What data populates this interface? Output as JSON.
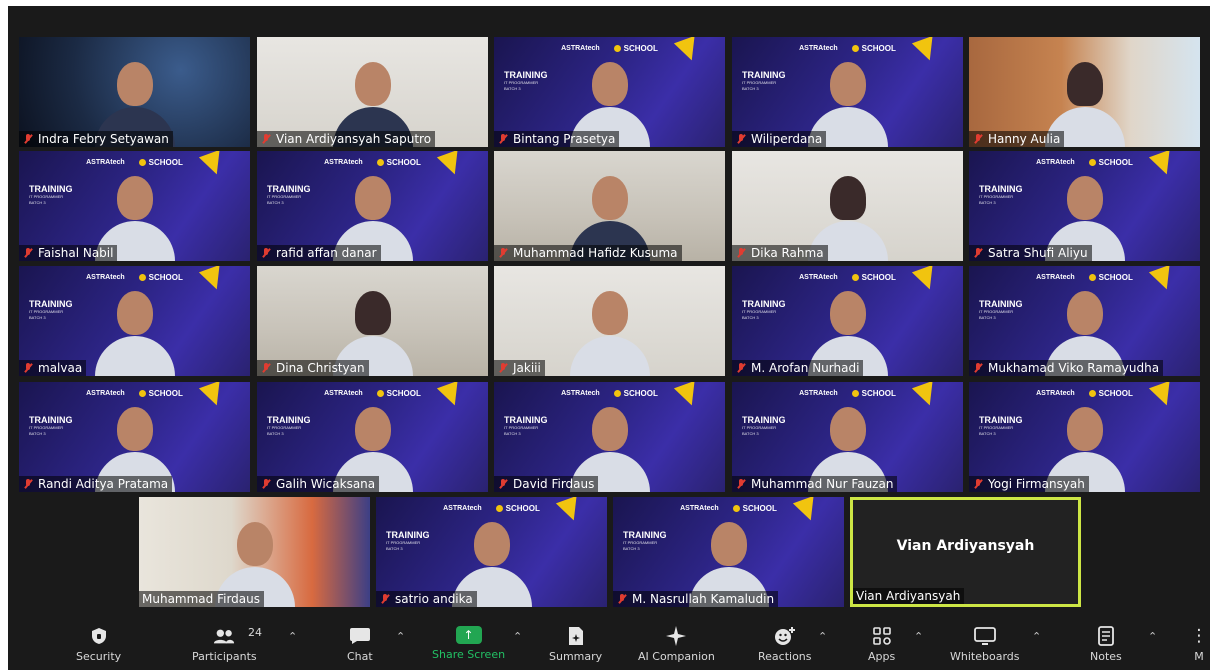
{
  "participants": [
    {
      "name": "Indra Febry Setyawan"
    },
    {
      "name": "Vian Ardiyansyah Saputro"
    },
    {
      "name": "Bintang Prasetya"
    },
    {
      "name": "Wiliperdana"
    },
    {
      "name": "Hanny Aulia"
    },
    {
      "name": "Faishal Nabil"
    },
    {
      "name": "rafid affan danar"
    },
    {
      "name": "Muhammad Hafidz Kusuma"
    },
    {
      "name": "Dika Rahma"
    },
    {
      "name": "Satra Shufi Aliyu"
    },
    {
      "name": "malvaa"
    },
    {
      "name": "Dina Christyan"
    },
    {
      "name": "Jakiii"
    },
    {
      "name": "M. Arofan Nurhadi"
    },
    {
      "name": "Mukhamad Viko Ramayudha"
    },
    {
      "name": "Randi Aditya Pratama"
    },
    {
      "name": "Galih Wicaksana"
    },
    {
      "name": "David Firdaus"
    },
    {
      "name": "Muhammad Nur Fauzan"
    },
    {
      "name": "Yogi Firmansyah"
    },
    {
      "name": "Muhammad Firdaus"
    },
    {
      "name": "satrio andika"
    },
    {
      "name": "M. Nasrullah Kamaludin"
    },
    {
      "name": "Vian Ardiyansyah"
    }
  ],
  "placeholder_tile": {
    "center_name": "Vian Ardiyansyah"
  },
  "banner": {
    "astra": "ASTRAtech",
    "school": "SCHOOL",
    "training": "TRAINING",
    "program": "IT PROGRAMMER",
    "batch": "BATCH 3"
  },
  "toolbar": {
    "security": "Security",
    "participants": "Participants",
    "participants_count": "24",
    "chat": "Chat",
    "share_screen": "Share Screen",
    "summary": "Summary",
    "ai_companion": "AI Companion",
    "reactions": "Reactions",
    "apps": "Apps",
    "whiteboards": "Whiteboards",
    "notes": "Notes",
    "more": "M"
  },
  "icons": {
    "security": "shield-icon",
    "participants": "people-icon",
    "chat": "speech-bubble-icon",
    "share_screen": "share-arrow-icon",
    "summary": "document-sparkle-icon",
    "ai_companion": "sparkle-icon",
    "reactions": "smiley-plus-icon",
    "apps": "apps-grid-icon",
    "whiteboards": "whiteboard-icon",
    "notes": "notes-icon",
    "muted_mic": "muted-mic-icon"
  },
  "colors": {
    "meeting_bg": "#1a1a1a",
    "active_speaker_border": "#cde645",
    "muted_red": "#e03c31",
    "share_green": "#22a652",
    "banner_purple": "#2c2484",
    "banner_yellow": "#f1c40f"
  }
}
